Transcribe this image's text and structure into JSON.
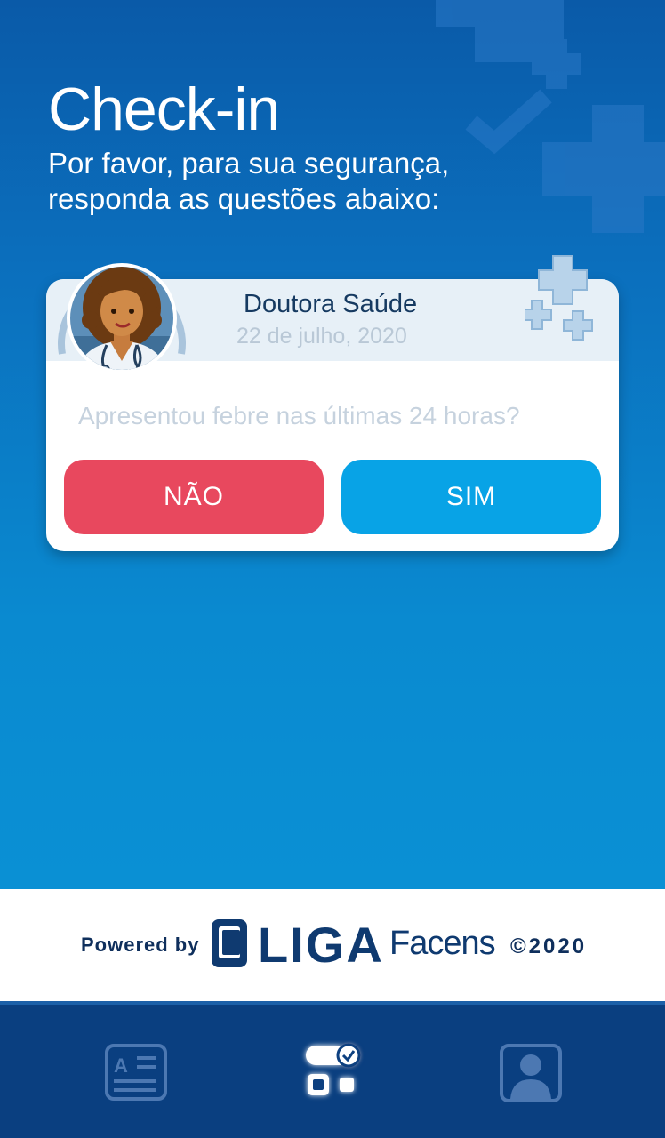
{
  "header": {
    "title": "Check-in",
    "subtitle": "Por favor, para sua segurança, responda as questões abaixo:"
  },
  "card": {
    "doctor_name": "Doutora Saúde",
    "date": "22 de julho, 2020",
    "question": "Apresentou febre nas últimas 24 horas?",
    "no_label": "NÃO",
    "yes_label": "SIM"
  },
  "footer": {
    "powered_by": "Powered by",
    "brand": "LIGA",
    "partner": "Facens",
    "copyright": "©2020"
  },
  "nav": {
    "items": [
      {
        "icon": "document-icon",
        "active": false
      },
      {
        "icon": "checkin-icon",
        "active": true
      },
      {
        "icon": "profile-icon",
        "active": false
      }
    ]
  },
  "colors": {
    "no_button": "#e8485e",
    "yes_button": "#08a3e6",
    "nav_background": "#0a3f80"
  }
}
